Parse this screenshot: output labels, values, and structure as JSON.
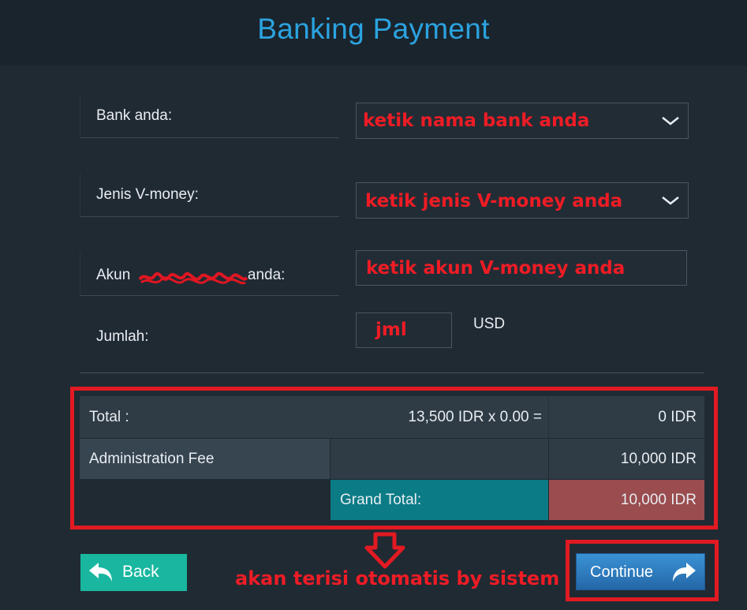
{
  "header": {
    "title": "Banking Payment"
  },
  "form": {
    "bank_label": "Bank anda:",
    "bank_value": "ketik nama bank anda",
    "vmoney_type_label": "Jenis V-money:",
    "vmoney_type_value": "ketik jenis V-money anda",
    "account_label_prefix": "Akun ",
    "account_label_suffix": " anda:",
    "account_value": "ketik akun V-money anda",
    "amount_label": "Jumlah:",
    "amount_value": "jml",
    "amount_currency": "USD"
  },
  "summary": {
    "total_label": "Total :",
    "total_formula": "13,500 IDR x 0.00 =",
    "total_value": "0 IDR",
    "fee_label": "Administration Fee",
    "fee_value": "10,000 IDR",
    "grand_total_label": "Grand Total:",
    "grand_total_value": "10,000 IDR"
  },
  "annotations": {
    "auto_fill_note": "akan terisi otomatis by sistem"
  },
  "buttons": {
    "back_label": "Back",
    "continue_label": "Continue"
  },
  "colors": {
    "accent_title": "#2ba3e0",
    "annotation_red": "#ee1c25",
    "back_button": "#19b79f",
    "continue_button": "#2e7fc0",
    "grand_total_teal": "#0b7c86",
    "grand_total_value_bg": "#9b4c4e"
  }
}
